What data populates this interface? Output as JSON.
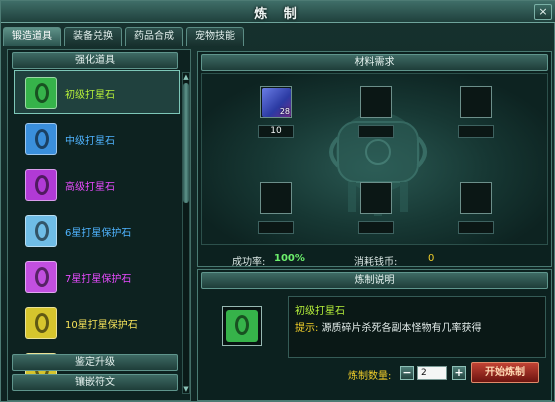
{
  "window": {
    "title": "炼 制",
    "close_label": "×"
  },
  "tabs": [
    {
      "label": "锻造道具"
    },
    {
      "label": "装备兑换"
    },
    {
      "label": "药品合成"
    },
    {
      "label": "宠物技能"
    }
  ],
  "left_panel": {
    "header": "强化道具",
    "items": [
      {
        "name": "初级打星石",
        "color": "#b7f13a",
        "gem_color": "#36b34a"
      },
      {
        "name": "中级打星石",
        "color": "#4fb4ff",
        "gem_color": "#3a8fdc"
      },
      {
        "name": "高级打星石",
        "color": "#e84bff",
        "gem_color": "#b13ad6"
      },
      {
        "name": "6星打星保护石",
        "color": "#4fb4ff",
        "gem_color": "#6fbde6"
      },
      {
        "name": "7星打星保护石",
        "color": "#e84bff",
        "gem_color": "#c24fe0"
      },
      {
        "name": "10星打星保护石",
        "color": "#f6e35a",
        "gem_color": "#d6c52d"
      },
      {
        "name": "",
        "color": "#f6e35a",
        "gem_color": "#d6c52d"
      }
    ],
    "footer_1": "鉴定升级",
    "footer_2": "镶嵌符文"
  },
  "materials": {
    "header": "材料需求",
    "slot_1_count_badge": "28",
    "slot_1_quantity": "10",
    "success_label": "成功率:",
    "success_value": "100%",
    "cost_label": "消耗钱币:",
    "cost_value": "0"
  },
  "description": {
    "header": "炼制说明",
    "item_name": "初级打星石",
    "hint_label": "提示:",
    "hint_text": "源质碎片杀死各副本怪物有几率获得",
    "quantity_label": "炼制数量:",
    "minus": "−",
    "quantity": "2",
    "plus": "+",
    "start_button": "开始炼制"
  },
  "colors": {
    "accent_green": "#b7f13a",
    "success_green": "#6cf06c",
    "cost_yellow": "#f2cf2a",
    "button_red": "#a52a1e"
  }
}
